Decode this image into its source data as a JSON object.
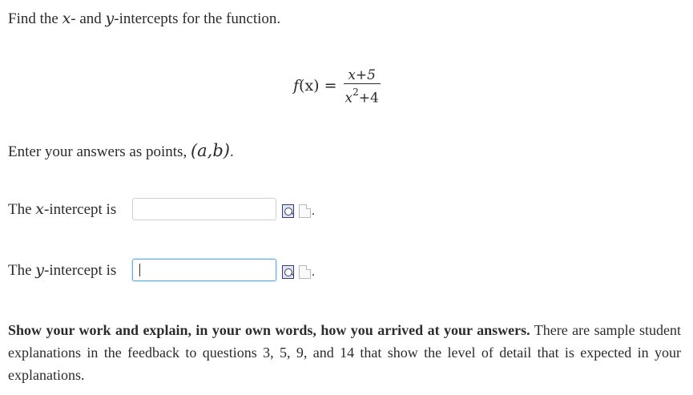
{
  "question": {
    "instruction_prefix": "Find the ",
    "instruction_x": "x",
    "instruction_mid": "- and ",
    "instruction_y": "y",
    "instruction_suffix": "-intercepts for the function."
  },
  "equation": {
    "lhs_f": "f",
    "lhs_arg": "(x)",
    "equals": "=",
    "numerator": "x+5",
    "denominator_base": "x",
    "denominator_exp": "2",
    "denominator_rest": "+4"
  },
  "format_hint": {
    "text": "Enter your answers as points, ",
    "point": "(a,b)",
    "period": "."
  },
  "x_intercept": {
    "label_prefix": "The ",
    "label_var": "x",
    "label_suffix": "-intercept is",
    "value": "",
    "after": "."
  },
  "y_intercept": {
    "label_prefix": "The ",
    "label_var": "y",
    "label_suffix": "-intercept is",
    "value": "",
    "after": "."
  },
  "explanation": {
    "bold": "Show your work and explain, in your own words, how you arrived at your answers.",
    "rest": " There are sample student explanations in the feedback to questions 3, 5, 9, and 14 that show the level of detail that is expected in your explanations."
  },
  "icons": {
    "preview": "preview-answer-icon",
    "help": "entry-help-icon"
  }
}
